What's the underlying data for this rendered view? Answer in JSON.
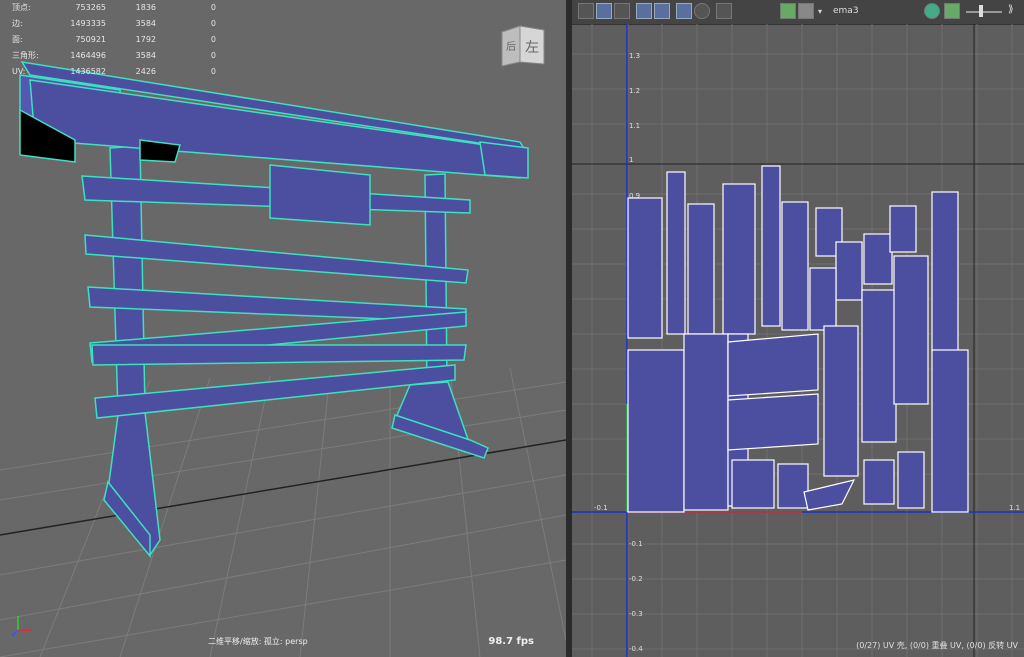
{
  "hud": {
    "rows": [
      {
        "label": "顶点:",
        "v1": "753265",
        "v2": "1836",
        "v3": "0"
      },
      {
        "label": "边:",
        "v1": "1493335",
        "v2": "3584",
        "v3": "0"
      },
      {
        "label": "面:",
        "v1": "750921",
        "v2": "1792",
        "v3": "0"
      },
      {
        "label": "三角形:",
        "v1": "1464496",
        "v2": "3584",
        "v3": "0"
      },
      {
        "label": "UV:",
        "v1": "1436582",
        "v2": "2426",
        "v3": "0"
      }
    ]
  },
  "viewport": {
    "camera_label": "二维平移/缩放: 孤立: persp",
    "fps": "98.7 fps",
    "viewcube_back": "后",
    "viewcube_left": "左"
  },
  "uv_editor": {
    "uv_set_name": "ema3",
    "status": "(0/27) UV 壳, (0/0) 重叠 UV, (0/0) 反转 UV",
    "v_ticks": [
      "1.3",
      "1.2",
      "1.1",
      "1",
      "0.9",
      "-0.1",
      "-0.2",
      "-0.3",
      "-0.4"
    ],
    "u_ticks": [
      "-0.1",
      "1.1"
    ]
  },
  "colors": {
    "mesh_fill": "#4c4ea0",
    "wire_highlight": "#3de0c0",
    "uv_line": "#ffffff",
    "axis_blue": "#1b2fd0"
  }
}
